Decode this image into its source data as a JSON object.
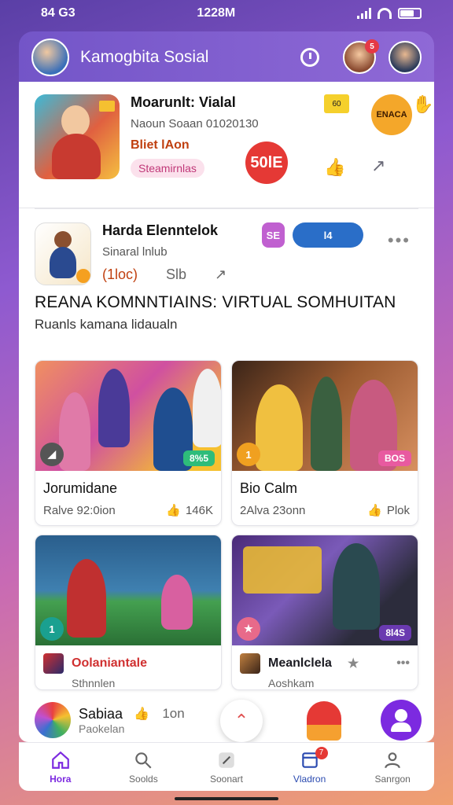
{
  "status_bar": {
    "time_left": "84 G3",
    "time_center": "1228M"
  },
  "header": {
    "title": "Kamogbita Sosial",
    "notif_count": "5"
  },
  "feed": [
    {
      "title": "Moarunlt: Vialal",
      "subtitle": "Naoun Soaan 01020130",
      "meta": "Bliet lAon",
      "chip": "Steamirnlas",
      "circle_text": "50lE",
      "sticker_text": "60",
      "badge_text": "ENACA"
    },
    {
      "title": "Harda Elenntelok",
      "subtitle": "Sinaral lnlub",
      "meta": "(1loc)",
      "action_count": "Slb",
      "sticker1": "SE",
      "sticker2": "l4"
    }
  ],
  "section": {
    "title": "REANA KOMNNTIAINS: VIRTUAL SOMHUITAN",
    "subtitle": "Ruanls kamana lidaualn"
  },
  "cards": [
    {
      "title": "Jorumidane",
      "sub": "Ralve 92:0ion",
      "likes": "146K",
      "tag": "8%5",
      "accent": "#2ebc7a",
      "badge_color": "#555"
    },
    {
      "title": "Bio Calm",
      "sub": "2Alva 23onn",
      "likes": "Plok",
      "tag": "BOS",
      "accent": "#e85aa0",
      "badge_color": "#f0a020"
    },
    {
      "title": "Oolaniantale",
      "sub": "Sthnnlen",
      "tag": "",
      "accent": "#d03030",
      "badge_color": "#1aa090"
    },
    {
      "title": "Meanlclela",
      "sub": "Aoshkam",
      "tag": "8l4S",
      "accent": "#6a3ab0",
      "badge_color": "#e86a8a"
    }
  ],
  "bottom_strip": {
    "name": "Sabiaa",
    "sub": "Paokelan",
    "count": "1on"
  },
  "nav": [
    {
      "label": "Hora",
      "icon": "home-icon"
    },
    {
      "label": "Soolds",
      "icon": "search-icon"
    },
    {
      "label": "Soonart",
      "icon": "compose-icon"
    },
    {
      "label": "Vladron",
      "icon": "messages-icon",
      "badge": "7"
    },
    {
      "label": "Sanrgon",
      "icon": "profile-icon"
    }
  ],
  "colors": {
    "accent": "#7c2ae0",
    "header": "#7355c8",
    "danger": "#e53935"
  }
}
